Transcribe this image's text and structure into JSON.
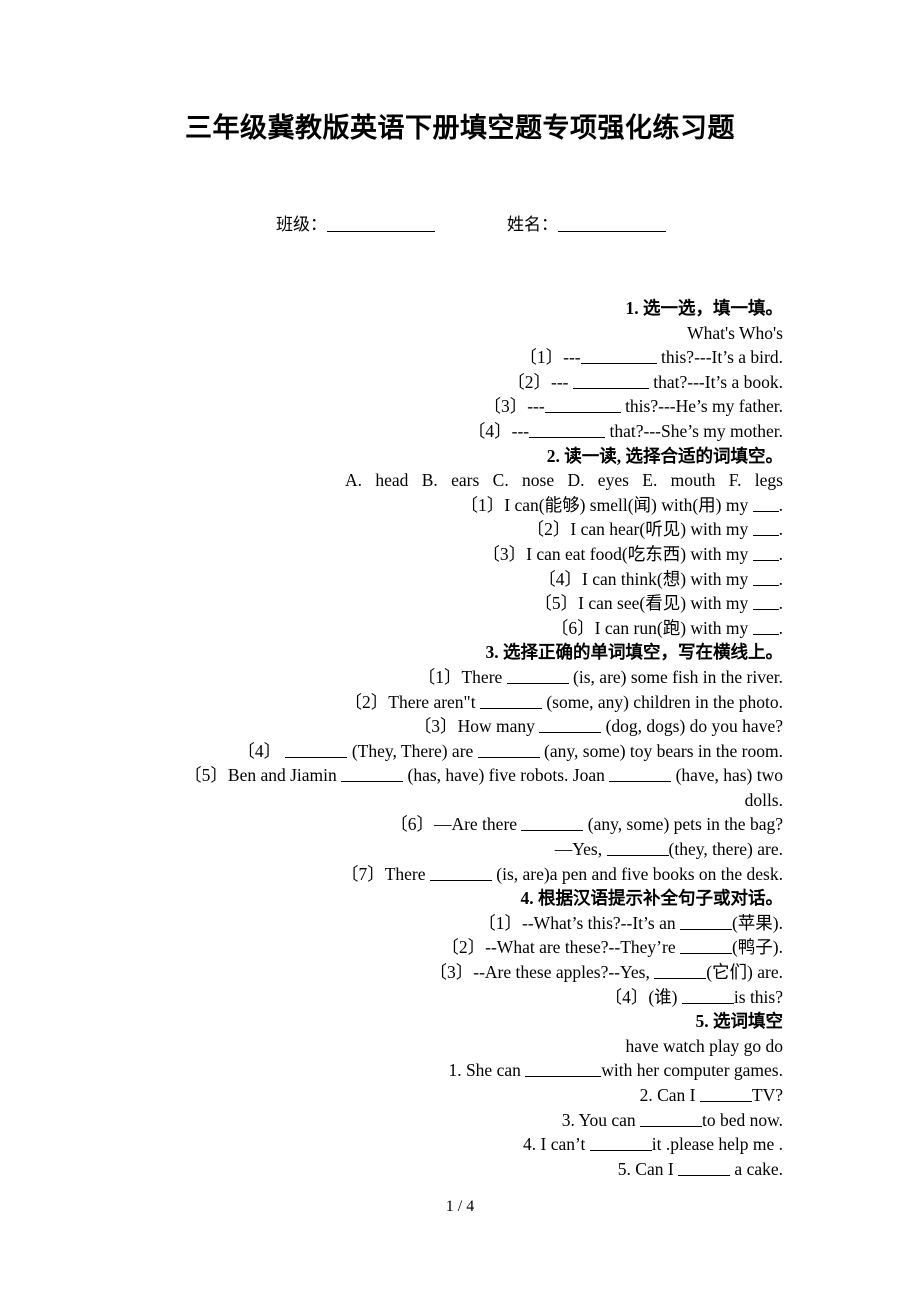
{
  "document": {
    "title": "三年级冀教版英语下册填空题专项强化练习题",
    "class_label": "班级：",
    "name_label": "姓名：",
    "footer": "1 / 4"
  },
  "sections": [
    {
      "heading": "1. 选一选，填一填。",
      "wordbank": "What's  Who's",
      "items": [
        "〔1〕---",
        "〔2〕--- ",
        "〔3〕---",
        "〔4〕---"
      ],
      "items_full": [
        "〔1〕--- ________ this?---It's a bird.",
        "〔2〕--- ________ that?---It's a book.",
        "〔3〕--- ________ this?---He's my father.",
        "〔4〕--- ________ that?---She's my mother."
      ],
      "parts": [
        {
          "num": "〔1〕",
          "pre": "---",
          "post": " this?---It’s a bird."
        },
        {
          "num": "〔2〕",
          "pre": "--- ",
          "post": " that?---It’s a book."
        },
        {
          "num": "〔3〕",
          "pre": "---",
          "post": " this?---He’s my father."
        },
        {
          "num": "〔4〕",
          "pre": "---",
          "post": " that?---She’s my mother."
        }
      ]
    },
    {
      "heading": "2. 读一读, 选择合适的词填空。",
      "options": [
        "A. head",
        "B. ears",
        "C. nose",
        "D. eyes",
        "E. mouth",
        "F. legs"
      ],
      "parts": [
        {
          "num": "〔1〕",
          "pre": "I can(能够) smell(闻) with(用) my ",
          "post": "."
        },
        {
          "num": "〔2〕",
          "pre": "I can hear(听见) with my ",
          "post": "."
        },
        {
          "num": "〔3〕",
          "pre": "I can eat food(吃东西) with my ",
          "post": "."
        },
        {
          "num": "〔4〕",
          "pre": "I can think(想) with my ",
          "post": "."
        },
        {
          "num": "〔5〕",
          "pre": "I can see(看见) with my ",
          "post": "."
        },
        {
          "num": "〔6〕",
          "pre": "I can run(跑) with my ",
          "post": "."
        }
      ]
    },
    {
      "heading": "3. 选择正确的单词填空，写在横线上。",
      "parts": [
        {
          "num": "〔1〕",
          "pre": "There ",
          "post": " (is, are) some fish in the river."
        },
        {
          "num": "〔2〕",
          "pre": "There aren\"t ",
          "post": " (some, any) children in the photo."
        },
        {
          "num": "〔3〕",
          "pre": "How many ",
          "post": " (dog, dogs) do you have?"
        },
        {
          "num": "〔4〕",
          "pre": " ",
          "mid": " (They, There) are ",
          "post": " (any, some) toy bears in the room."
        },
        {
          "num": "〔5〕",
          "pre": "Ben and Jiamin ",
          "mid": " (has, have) five robots. Joan ",
          "post": " (have, has) two",
          "wrap": "dolls."
        },
        {
          "num": "〔6〕",
          "pre": "—Are there ",
          "post": " (any, some) pets in the bag?",
          "wrap": "—Yes, ____(they, there) are.",
          "wrap_pre": "—Yes, ",
          "wrap_post": "(they, there) are."
        },
        {
          "num": "〔7〕",
          "pre": "There ",
          "post": " (is, are)a pen and five books on the desk."
        }
      ]
    },
    {
      "heading": "4. 根据汉语提示补全句子或对话。",
      "parts": [
        {
          "num": "〔1〕",
          "pre": "--What’s this?--It’s an ",
          "post": "(苹果)."
        },
        {
          "num": "〔2〕",
          "pre": "--What are these?--They’re ",
          "post": "(鸭子)."
        },
        {
          "num": "〔3〕",
          "pre": "--Are these apples?--Yes, ",
          "post": "(它们) are."
        },
        {
          "num": "〔4〕",
          "pre": "(谁) ",
          "post": "is this?"
        }
      ]
    },
    {
      "heading": "5. 选词填空",
      "wordbank": "have watch play go do",
      "parts": [
        {
          "num": "1.",
          "pre": "She can ",
          "post": "with her computer games."
        },
        {
          "num": "2.",
          "pre": "Can I ",
          "post": "TV?"
        },
        {
          "num": "3.",
          "pre": "You can ",
          "post": "to bed now."
        },
        {
          "num": "4.",
          "pre": "I can’t ",
          "post": "it .please help me ."
        },
        {
          "num": "5.",
          "pre": "Can I ",
          "post": " a cake."
        }
      ]
    }
  ]
}
